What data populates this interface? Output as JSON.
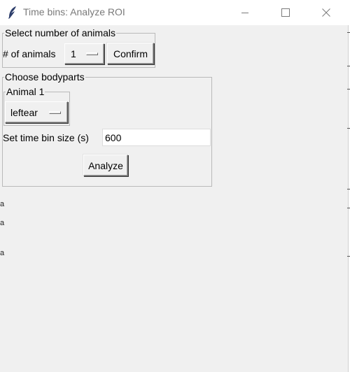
{
  "window": {
    "title": "Time bins: Analyze ROI",
    "minimize_glyph": "—",
    "maximize_glyph": "☐",
    "close_glyph": "✕",
    "app_icon": "feather-icon"
  },
  "animals_group": {
    "legend": "Select number of animals",
    "count_label": "# of animals",
    "count_value": "1",
    "confirm_label": "Confirm"
  },
  "bodyparts_group": {
    "legend": "Choose bodyparts",
    "animal_1": {
      "legend": "Animal 1",
      "bodypart_value": "leftear"
    },
    "bin_size_label": "Set time bin size (s)",
    "bin_size_value": "600",
    "analyze_label": "Analyze"
  },
  "left_edge_artifacts": [
    "a",
    "a",
    "a"
  ]
}
